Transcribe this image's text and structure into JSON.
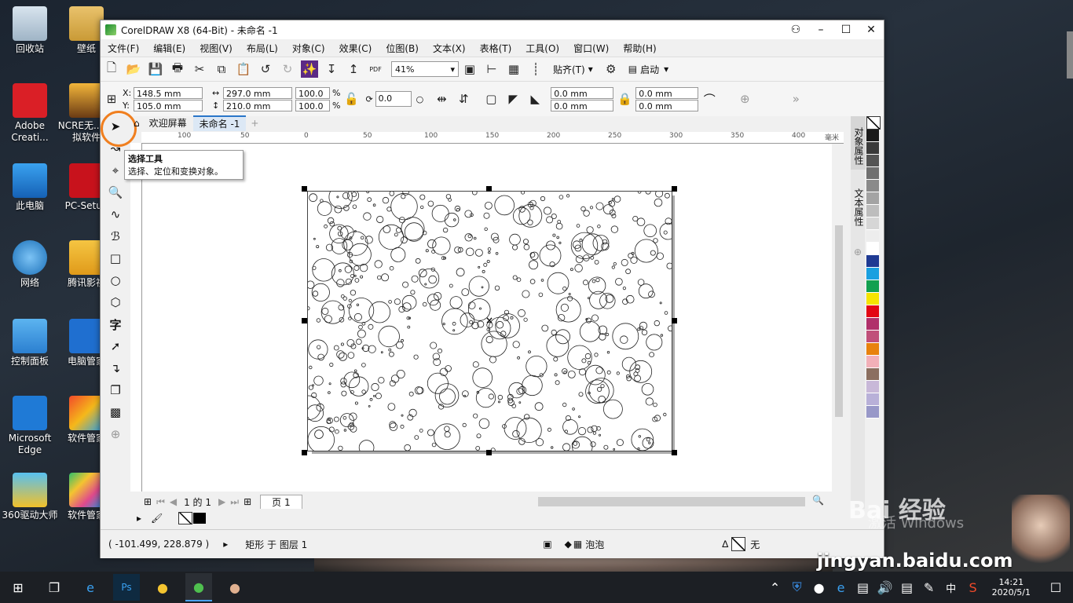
{
  "desktop": {
    "icons": [
      {
        "label": "回收站"
      },
      {
        "label": "壁纸"
      },
      {
        "label": "Adobe Creati..."
      },
      {
        "label": "NCRE无... 模拟软件"
      },
      {
        "label": "此电脑"
      },
      {
        "label": "PC-Setup"
      },
      {
        "label": "网络"
      },
      {
        "label": "腾讯影视"
      },
      {
        "label": "控制面板"
      },
      {
        "label": "电脑管家"
      },
      {
        "label": "Microsoft Edge"
      },
      {
        "label": "软件管家"
      },
      {
        "label": "360驱动大师"
      },
      {
        "label": "软件管家"
      }
    ],
    "activation_text": "激活 Windows"
  },
  "window": {
    "title": "CorelDRAW X8 (64-Bit) - 未命名 -1",
    "menus": [
      "文件(F)",
      "编辑(E)",
      "视图(V)",
      "布局(L)",
      "对象(C)",
      "效果(C)",
      "位图(B)",
      "文本(X)",
      "表格(T)",
      "工具(O)",
      "窗口(W)",
      "帮助(H)"
    ],
    "zoom": "41%",
    "snap_label": "贴齐(T)",
    "launch_label": "启动",
    "pdf_label": "PDF",
    "props": {
      "x": "148.5 mm",
      "y": "105.0 mm",
      "width": "297.0 mm",
      "height": "210.0 mm",
      "scale_x": "100.0",
      "scale_y": "100.0",
      "percent": "%",
      "rotation": "0.0",
      "corner_1": "0.0 mm",
      "corner_2": "0.0 mm",
      "corner_3": "0.0 mm",
      "corner_4": "0.0 mm",
      "x_label": "X:",
      "y_label": "Y:"
    },
    "tabs": [
      "欢迎屏幕",
      "未命名 -1"
    ],
    "ruler_unit": "毫米",
    "ruler_ticks": [
      "100",
      "50",
      "0",
      "50",
      "100",
      "150",
      "200",
      "250",
      "300",
      "350",
      "400"
    ],
    "tooltip": {
      "title": "选择工具",
      "desc": "选择、定位和变换对象。"
    },
    "pagebar": {
      "page_info": "1 的 1",
      "page_tab": "页 1"
    },
    "dockers": [
      "对象属性",
      "文本属性"
    ],
    "palette": [
      "#ffffff",
      "#1a1a1a",
      "#3a3a3a",
      "#555555",
      "#707070",
      "#8a8a8a",
      "#a3a3a3",
      "#bdbdbd",
      "#d6d6d6",
      "#ededed",
      "#ffffff",
      "#1f3a93",
      "#1aa0e0",
      "#12a050",
      "#f5e400",
      "#e30613",
      "#b0306a",
      "#c0507a",
      "#e8820c",
      "#f2b0b8",
      "#8b6f60",
      "#c8b8d8",
      "#b8b0d8",
      "#9898c8"
    ],
    "status": {
      "coords": "( -101.499, 228.879 )",
      "object": "矩形 于 图层 1",
      "fill_name": "泡泡",
      "outline": "无"
    }
  },
  "taskbar": {
    "ime": "中",
    "time": "14:21",
    "date": "2020/5/1"
  },
  "watermark": {
    "text": "Bai 经验",
    "url": "jingyan.baidu.com"
  }
}
